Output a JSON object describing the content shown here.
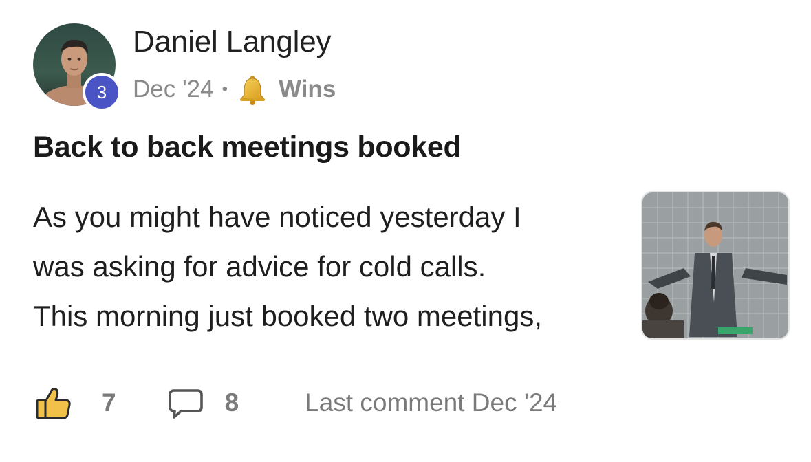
{
  "post": {
    "author": {
      "name": "Daniel Langley",
      "level": "3",
      "avatar_icon": "user-avatar-photo"
    },
    "meta": {
      "date": "Dec '24",
      "separator": "•",
      "category_icon": "bell-icon",
      "category": "Wins"
    },
    "title": "Back to back meetings booked",
    "body_lines": [
      "As you might have noticed yesterday I",
      "was asking for advice for cold calls.",
      "This morning just booked two meetings,"
    ],
    "thumbnail_icon": "man-in-suit-gif-thumbnail",
    "footer": {
      "like_icon": "thumbs-up-icon",
      "likes": "7",
      "comment_icon": "comment-bubble-icon",
      "comments": "8",
      "last_comment": "Last comment Dec '24"
    },
    "colors": {
      "level_badge": "#4a54c4",
      "muted_text": "#8a8a8a",
      "like_icon": "#f2c14a"
    }
  }
}
